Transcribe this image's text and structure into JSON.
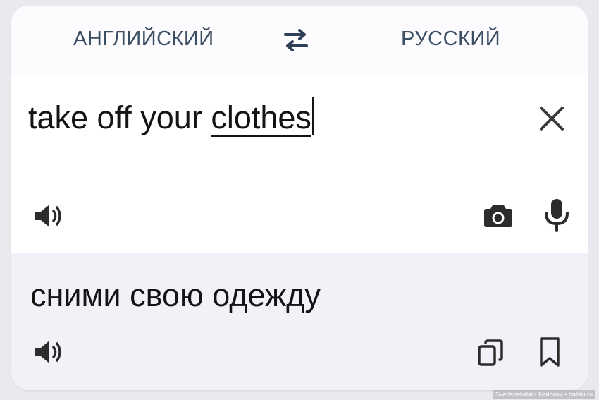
{
  "header": {
    "source_language": "АНГЛИЙСКИЙ",
    "target_language": "РУССКИЙ",
    "swap_icon": "swap-arrows-icon"
  },
  "input": {
    "text_plain": "take off your ",
    "text_underlined": "clothes",
    "clear_icon": "close-icon",
    "speaker_icon": "speaker-icon",
    "camera_icon": "camera-icon",
    "mic_icon": "microphone-icon"
  },
  "output": {
    "text": "сними свою одежду",
    "speaker_icon": "speaker-icon",
    "copy_icon": "copy-icon",
    "bookmark_icon": "bookmark-icon"
  },
  "watermark": "Svetlanalialai • Бэйбики • babiki.ru",
  "colors": {
    "background": "#e9eaef",
    "card": "#ffffff",
    "output_background": "#f1f2f7",
    "language_text": "#3c4e64",
    "text": "#141414"
  }
}
